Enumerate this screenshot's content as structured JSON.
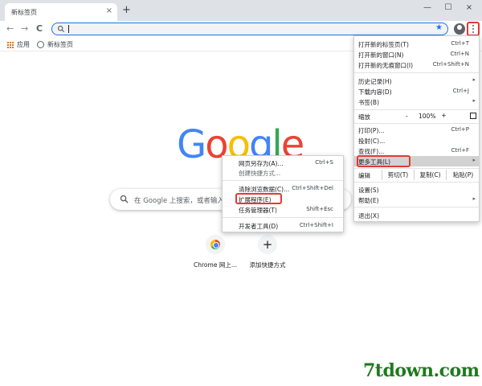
{
  "tab": {
    "title": "新标签页",
    "close": "×"
  },
  "new_tab_button": "+",
  "window_controls": {
    "minimize": "—",
    "maximize": "☐",
    "close": "×"
  },
  "nav": {
    "back": "←",
    "forward": "→",
    "reload": "C"
  },
  "omnibox": {
    "value": ""
  },
  "bookmarks": [
    {
      "label": "应用",
      "icon": "apps-icon"
    },
    {
      "label": "新标签页",
      "icon": "globe-icon"
    }
  ],
  "google_logo": [
    "G",
    "o",
    "o",
    "g",
    "l",
    "e"
  ],
  "search_placeholder": "在 Google 上搜索，或者输入网址",
  "shortcuts": [
    {
      "label": "Chrome 网上...",
      "icon": "chrome-icon"
    },
    {
      "label": "添加快捷方式",
      "icon": "+"
    }
  ],
  "main_menu": {
    "new_tab": {
      "label": "打开新的标签页(T)",
      "shortcut": "Ctrl+T"
    },
    "new_window": {
      "label": "打开新的窗口(N)",
      "shortcut": "Ctrl+N"
    },
    "incognito": {
      "label": "打开新的无痕窗口(I)",
      "shortcut": "Ctrl+Shift+N"
    },
    "history": {
      "label": "历史记录(H)"
    },
    "downloads": {
      "label": "下载内容(D)",
      "shortcut": "Ctrl+J"
    },
    "bookmarks": {
      "label": "书签(B)"
    },
    "zoom": {
      "label": "缩放",
      "minus": "-",
      "value": "100%",
      "plus": "+"
    },
    "print": {
      "label": "打印(P)...",
      "shortcut": "Ctrl+P"
    },
    "cast": {
      "label": "投射(C)..."
    },
    "find": {
      "label": "查找(F)...",
      "shortcut": "Ctrl+F"
    },
    "more_tools": {
      "label": "更多工具(L)"
    },
    "edit": {
      "label": "编辑",
      "cut": "剪切(T)",
      "copy": "复制(C)",
      "paste": "粘贴(P)"
    },
    "settings": {
      "label": "设置(S)"
    },
    "help": {
      "label": "帮助(E)"
    },
    "exit": {
      "label": "退出(X)"
    }
  },
  "more_tools_menu": {
    "save_page": {
      "label": "网页另存为(A)...",
      "shortcut": "Ctrl+S"
    },
    "create_shortcut": {
      "label": "创建快捷方式..."
    },
    "clear_data": {
      "label": "清除浏览数据(C)...",
      "shortcut": "Ctrl+Shift+Del"
    },
    "extensions": {
      "label": "扩展程序(E)"
    },
    "task_manager": {
      "label": "任务管理器(T)",
      "shortcut": "Shift+Esc"
    },
    "dev_tools": {
      "label": "开发者工具(D)",
      "shortcut": "Ctrl+Shift+I"
    }
  },
  "watermark": "7tdown.com",
  "colors": {
    "accent": "#1a73e8",
    "highlight_box": "#e53935",
    "menu_hover": "#d2d2d2"
  }
}
